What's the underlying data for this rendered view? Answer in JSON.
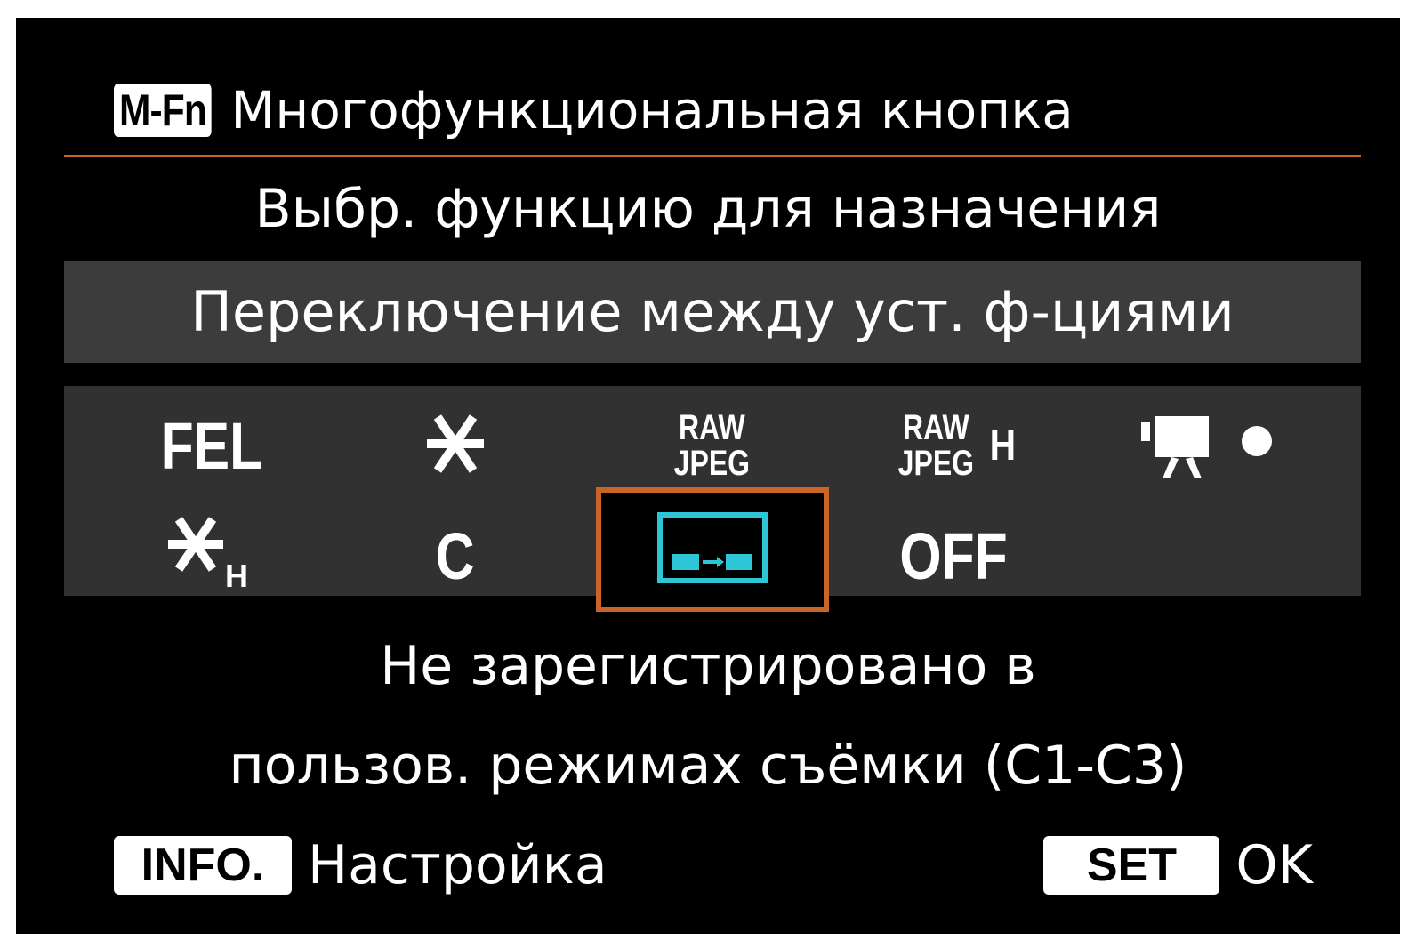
{
  "header": {
    "badge": "M-Fn",
    "title": "Многофункциональная кнопка"
  },
  "subtitle": "Выбр. функцию для назначения",
  "selected_function": "Переключение между уст. ф-циями",
  "colors": {
    "accent": "#c9642a",
    "highlight_bar": "#3c3c3c",
    "grid_background": "#313131",
    "cyan_icon": "#2ec6d6"
  },
  "options": {
    "fel": "FEL",
    "ae_lock_icon": "asterisk-icon",
    "raw_top": "RAW",
    "raw_bottom": "JPEG",
    "raw2_top": "RAW",
    "raw2_bottom": "JPEG",
    "raw2_suffix": "H",
    "movie_icon": "movie-record-icon",
    "ae_lock_hold_icon": "asterisk-hold-icon",
    "ae_lock_hold_sub": "H",
    "c": "C",
    "switch_icon": "switch-registered-functions-icon",
    "off": "OFF"
  },
  "info": {
    "line1": "Не зарегистрировано в",
    "line2": "пользов. режимах съёмки (С1-С3)"
  },
  "footer": {
    "info_key": "INFO.",
    "info_label": "Настройка",
    "set_key": "SET",
    "set_label": "OK"
  }
}
